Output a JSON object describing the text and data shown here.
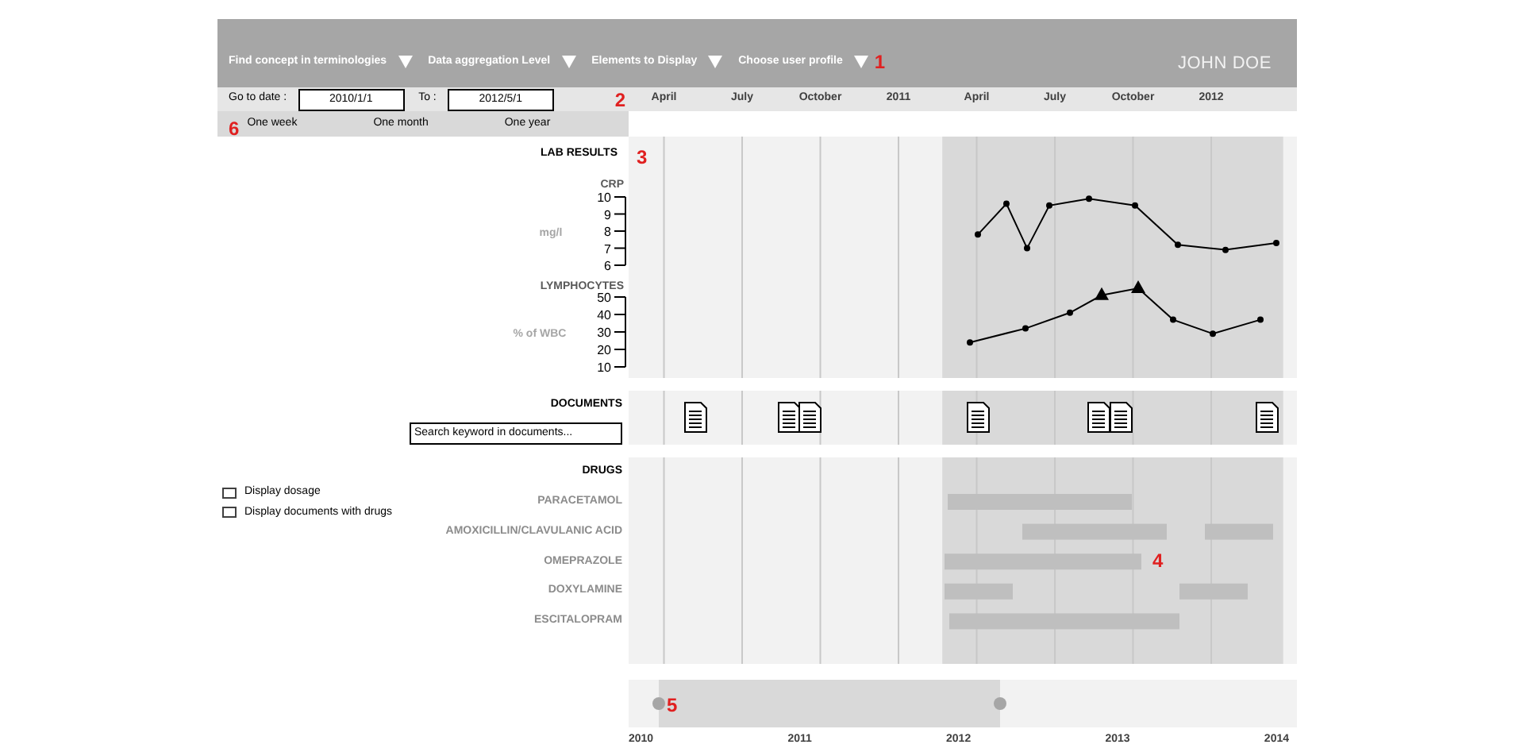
{
  "toolbar": {
    "menus": [
      {
        "label": "Find concept in terminologies"
      },
      {
        "label": "Data aggregation Level"
      },
      {
        "label": "Elements to Display"
      },
      {
        "label": "Choose user profile"
      }
    ],
    "callout": "1",
    "user": "JOHN DOE"
  },
  "date_range": {
    "from_label": "Go to date :",
    "from": "2010/1/1",
    "to_label": "To :",
    "to": "2012/5/1",
    "callout": "2"
  },
  "timeline_labels": [
    "April",
    "July",
    "October",
    "2011",
    "April",
    "July",
    "October",
    "2012"
  ],
  "zoom_presets": {
    "callout": "6",
    "options": [
      "One week",
      "One month",
      "One year"
    ]
  },
  "lab_results": {
    "title": "LAB RESULTS",
    "callout": "3",
    "charts": [
      {
        "kind": "crp",
        "title": "CRP",
        "unit": "mg/l",
        "ticks": [
          "10",
          "9",
          "8",
          "7",
          "6"
        ]
      },
      {
        "kind": "lymphocytes",
        "title": "LYMPHOCYTES",
        "unit": "% of WBC",
        "ticks": [
          "50",
          "40",
          "30",
          "20",
          "10"
        ]
      }
    ]
  },
  "documents": {
    "title": "DOCUMENTS",
    "search": {
      "placeholder": "Search keyword in documents..."
    },
    "items": [
      {
        "kind": "document"
      },
      {
        "kind": "document"
      },
      {
        "kind": "document"
      },
      {
        "kind": "document"
      },
      {
        "kind": "document"
      },
      {
        "kind": "document"
      },
      {
        "kind": "document"
      }
    ]
  },
  "drugs": {
    "title": "DRUGS",
    "callout": "4",
    "options": [
      {
        "label": "Display dosage",
        "checked": false
      },
      {
        "label": "Display documents with drugs",
        "checked": false
      }
    ],
    "rows": [
      {
        "name": "PARACETAMOL",
        "periods": [
          {
            "kind": "bar"
          }
        ]
      },
      {
        "name": "AMOXICILLIN/CLAVULANIC ACID",
        "periods": [
          {
            "kind": "bar"
          },
          {
            "kind": "bar"
          }
        ]
      },
      {
        "name": "OMEPRAZOLE",
        "periods": [
          {
            "kind": "bar"
          }
        ]
      },
      {
        "name": "DOXYLAMINE",
        "periods": [
          {
            "kind": "bar"
          },
          {
            "kind": "bar"
          }
        ]
      },
      {
        "name": "ESCITALOPRAM",
        "periods": [
          {
            "kind": "bar"
          }
        ]
      }
    ]
  },
  "scroller": {
    "callout": "5",
    "handles": [
      {
        "level": 0.045
      },
      {
        "level": 0.557
      }
    ],
    "years": [
      "2010",
      "2011",
      "2012",
      "2013",
      "2014"
    ]
  }
}
